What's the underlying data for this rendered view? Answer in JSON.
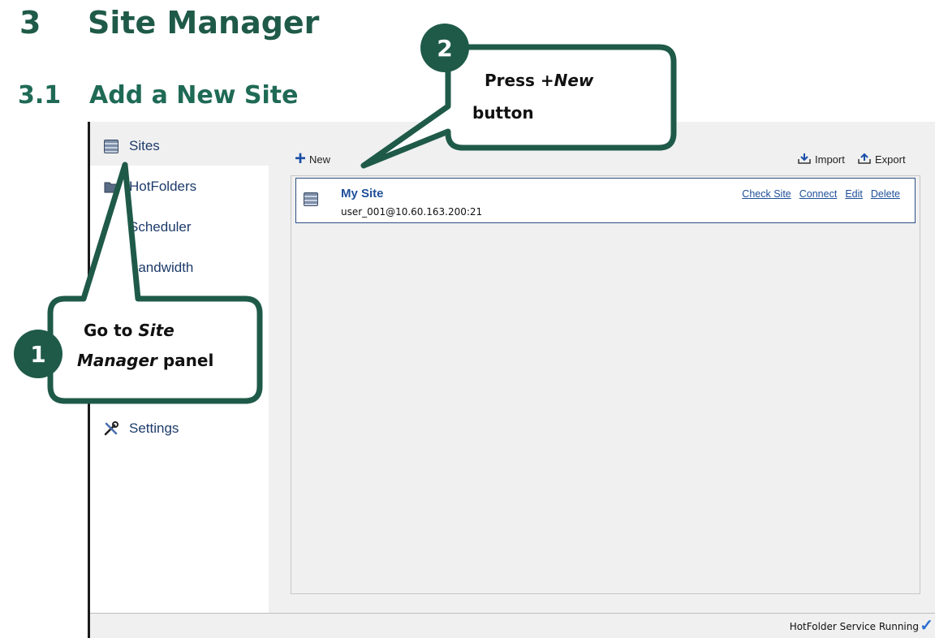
{
  "doc": {
    "section_number": "3",
    "section_title": "Site Manager",
    "subsection_number": "3.1",
    "subsection_title": "Add a New Site"
  },
  "sidebar": {
    "items": [
      {
        "label": "Sites",
        "icon": "server-stack-icon"
      },
      {
        "label": "HotFolders",
        "icon": "folder-icon"
      },
      {
        "label": "Scheduler",
        "icon": "clock-icon"
      },
      {
        "label": "Bandwidth",
        "icon": "gauge-icon"
      },
      {
        "label": "Settings",
        "icon": "wrench-screwdriver-icon"
      }
    ]
  },
  "toolbar": {
    "new_label": "New",
    "import_label": "Import",
    "export_label": "Export"
  },
  "sites": [
    {
      "name": "My Site",
      "address": "user_001@10.60.163.200:21",
      "actions": [
        "Check Site",
        "Connect",
        "Edit",
        "Delete"
      ]
    }
  ],
  "status": {
    "text": "HotFolder Service Running"
  },
  "callouts": [
    {
      "number": "1",
      "line1_prefix": "Go to ",
      "line1_em": "Site",
      "line2_em": "Manager",
      "line2_suffix": " panel"
    },
    {
      "number": "2",
      "line1_prefix": "Press ",
      "line1_em": "+New",
      "line2": "button"
    }
  ],
  "colors": {
    "heading": "#1f5a48",
    "callout_border": "#1f5a48",
    "link": "#1f4f9a",
    "new_plus": "#1a4fa8"
  }
}
